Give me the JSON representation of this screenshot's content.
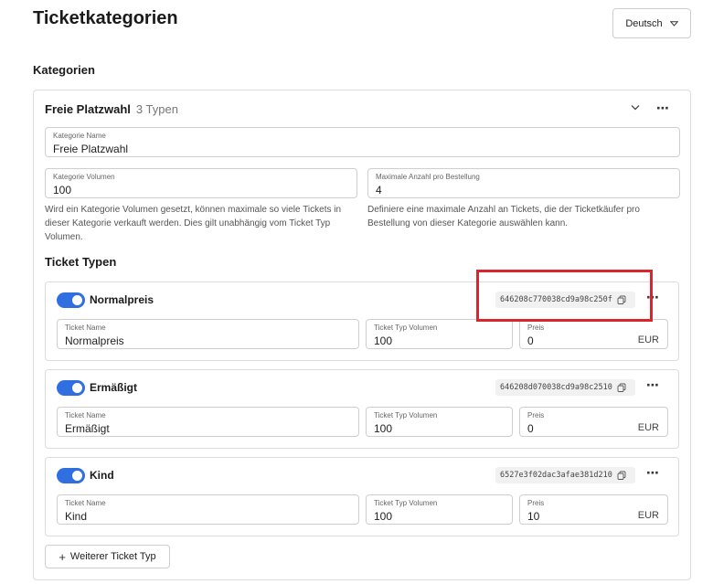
{
  "page": {
    "title": "Ticketkategorien",
    "language_selector": {
      "label": "Deutsch",
      "icon": "chevron-down-icon"
    }
  },
  "section": {
    "title": "Kategorien"
  },
  "category": {
    "name": "Freie Platzwahl",
    "type_count": "3 Typen",
    "fields": {
      "name": {
        "label": "Kategorie Name",
        "value": "Freie Platzwahl"
      },
      "volume": {
        "label": "Kategorie Volumen",
        "value": "100"
      },
      "max_per_order": {
        "label": "Maximale Anzahl pro Bestellung",
        "value": "4"
      }
    },
    "help_volume": "Wird ein Kategorie Volumen gesetzt, können maximale so viele Tickets in dieser Kategorie verkauft werden. Dies gilt unabhängig vom Ticket Typ Volumen.",
    "help_max": "Definiere eine maximale Anzahl an Tickets, die der Ticketkäufer pro Bestellung von dieser Kategorie auswählen kann."
  },
  "ticket_types": {
    "title": "Ticket Typen",
    "labels": {
      "name": "Ticket Name",
      "volume": "Ticket Typ Volumen",
      "price": "Preis",
      "currency": "EUR"
    },
    "items": [
      {
        "name": "Normalpreis",
        "enabled": true,
        "id": "646208c770038cd9a98c250f",
        "volume": "100",
        "price": "0"
      },
      {
        "name": "Ermäßigt",
        "enabled": true,
        "id": "646208d070038cd9a98c2510",
        "volume": "100",
        "price": "0"
      },
      {
        "name": "Kind",
        "enabled": true,
        "id": "6527e3f02dac3afae381d210",
        "volume": "100",
        "price": "10"
      }
    ],
    "add_button": "Weiterer Ticket Typ"
  },
  "more_glyph": "⋯",
  "colors": {
    "toggle_on": "#2f6fe0",
    "highlight": "#d9262c"
  }
}
